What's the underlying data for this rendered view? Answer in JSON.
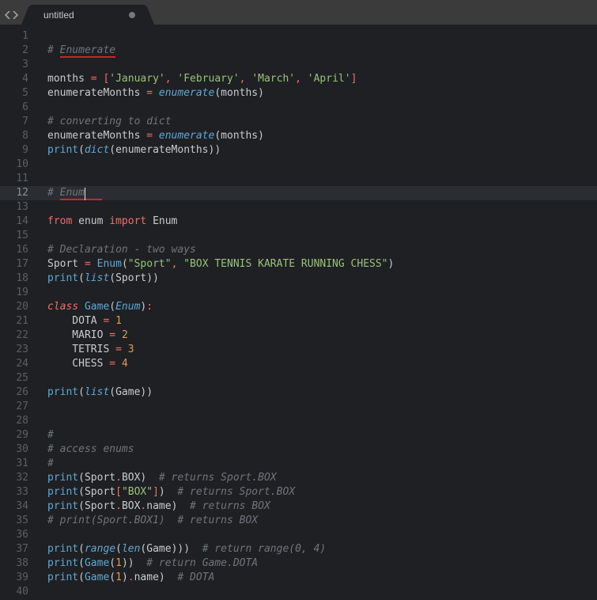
{
  "tab": {
    "title": "untitled",
    "modified": true
  },
  "gutter": {
    "start": 1,
    "end": 40,
    "active_line": 12
  },
  "underlines": {
    "enumerate": {
      "text": "Enumerate"
    },
    "enum": {
      "text": "Enum"
    }
  },
  "cursor": {
    "line": 12,
    "after_text": "# Enum"
  },
  "code": {
    "lines": [
      {
        "n": 1,
        "tokens": []
      },
      {
        "n": 2,
        "tokens": [
          {
            "t": "# ",
            "c": "cm"
          },
          {
            "t": "Enumerate",
            "c": "cm",
            "u": true
          }
        ]
      },
      {
        "n": 3,
        "tokens": []
      },
      {
        "n": 4,
        "tokens": [
          {
            "t": "months ",
            "c": "ident"
          },
          {
            "t": "=",
            "c": "op"
          },
          {
            "t": " ",
            "c": "txt"
          },
          {
            "t": "[",
            "c": "op"
          },
          {
            "t": "'January'",
            "c": "str"
          },
          {
            "t": ",",
            "c": "op"
          },
          {
            "t": " ",
            "c": "txt"
          },
          {
            "t": "'February'",
            "c": "str"
          },
          {
            "t": ",",
            "c": "op"
          },
          {
            "t": " ",
            "c": "txt"
          },
          {
            "t": "'March'",
            "c": "str"
          },
          {
            "t": ",",
            "c": "op"
          },
          {
            "t": " ",
            "c": "txt"
          },
          {
            "t": "'April'",
            "c": "str"
          },
          {
            "t": "]",
            "c": "op"
          }
        ]
      },
      {
        "n": 5,
        "tokens": [
          {
            "t": "enumerateMonths ",
            "c": "ident"
          },
          {
            "t": "=",
            "c": "op"
          },
          {
            "t": " ",
            "c": "txt"
          },
          {
            "t": "enumerate",
            "c": "cls"
          },
          {
            "t": "(",
            "c": "txt"
          },
          {
            "t": "months",
            "c": "ident"
          },
          {
            "t": ")",
            "c": "txt"
          }
        ]
      },
      {
        "n": 6,
        "tokens": []
      },
      {
        "n": 7,
        "tokens": [
          {
            "t": "# converting to dict",
            "c": "cm"
          }
        ]
      },
      {
        "n": 8,
        "tokens": [
          {
            "t": "enumerateMonths ",
            "c": "ident"
          },
          {
            "t": "=",
            "c": "op"
          },
          {
            "t": " ",
            "c": "txt"
          },
          {
            "t": "enumerate",
            "c": "cls"
          },
          {
            "t": "(",
            "c": "txt"
          },
          {
            "t": "months",
            "c": "ident"
          },
          {
            "t": ")",
            "c": "txt"
          }
        ]
      },
      {
        "n": 9,
        "tokens": [
          {
            "t": "print",
            "c": "fn"
          },
          {
            "t": "(",
            "c": "txt"
          },
          {
            "t": "dict",
            "c": "cls"
          },
          {
            "t": "(",
            "c": "txt"
          },
          {
            "t": "enumerateMonths",
            "c": "ident"
          },
          {
            "t": ")",
            "c": "txt"
          },
          {
            "t": ")",
            "c": "txt"
          }
        ]
      },
      {
        "n": 10,
        "tokens": []
      },
      {
        "n": 11,
        "tokens": []
      },
      {
        "n": 12,
        "active": true,
        "tokens": [
          {
            "t": "# ",
            "c": "cm"
          },
          {
            "t": "Enum",
            "c": "cm",
            "u": true,
            "caret_after": true
          }
        ]
      },
      {
        "n": 13,
        "tokens": []
      },
      {
        "n": 14,
        "tokens": [
          {
            "t": "from",
            "c": "kw"
          },
          {
            "t": " enum ",
            "c": "ident"
          },
          {
            "t": "import",
            "c": "kw"
          },
          {
            "t": " Enum",
            "c": "ident"
          }
        ]
      },
      {
        "n": 15,
        "tokens": []
      },
      {
        "n": 16,
        "tokens": [
          {
            "t": "# Declaration - two ways",
            "c": "cm"
          }
        ]
      },
      {
        "n": 17,
        "tokens": [
          {
            "t": "Sport ",
            "c": "ident"
          },
          {
            "t": "=",
            "c": "op"
          },
          {
            "t": " ",
            "c": "txt"
          },
          {
            "t": "Enum",
            "c": "fn"
          },
          {
            "t": "(",
            "c": "txt"
          },
          {
            "t": "\"Sport\"",
            "c": "str"
          },
          {
            "t": ",",
            "c": "op"
          },
          {
            "t": " ",
            "c": "txt"
          },
          {
            "t": "\"BOX TENNIS KARATE RUNNING CHESS\"",
            "c": "str"
          },
          {
            "t": ")",
            "c": "txt"
          }
        ]
      },
      {
        "n": 18,
        "tokens": [
          {
            "t": "print",
            "c": "fn"
          },
          {
            "t": "(",
            "c": "txt"
          },
          {
            "t": "list",
            "c": "cls"
          },
          {
            "t": "(",
            "c": "txt"
          },
          {
            "t": "Sport",
            "c": "ident"
          },
          {
            "t": ")",
            "c": "txt"
          },
          {
            "t": ")",
            "c": "txt"
          }
        ]
      },
      {
        "n": 19,
        "tokens": []
      },
      {
        "n": 20,
        "tokens": [
          {
            "t": "class",
            "c": "stor"
          },
          {
            "t": " ",
            "c": "txt"
          },
          {
            "t": "Game",
            "c": "fn"
          },
          {
            "t": "(",
            "c": "txt"
          },
          {
            "t": "Enum",
            "c": "cls"
          },
          {
            "t": ")",
            "c": "txt"
          },
          {
            "t": ":",
            "c": "op"
          }
        ]
      },
      {
        "n": 21,
        "tokens": [
          {
            "t": "    DOTA ",
            "c": "ident"
          },
          {
            "t": "=",
            "c": "op"
          },
          {
            "t": " ",
            "c": "txt"
          },
          {
            "t": "1",
            "c": "num"
          }
        ]
      },
      {
        "n": 22,
        "tokens": [
          {
            "t": "    MARIO ",
            "c": "ident"
          },
          {
            "t": "=",
            "c": "op"
          },
          {
            "t": " ",
            "c": "txt"
          },
          {
            "t": "2",
            "c": "num"
          }
        ]
      },
      {
        "n": 23,
        "tokens": [
          {
            "t": "    TETRIS ",
            "c": "ident"
          },
          {
            "t": "=",
            "c": "op"
          },
          {
            "t": " ",
            "c": "txt"
          },
          {
            "t": "3",
            "c": "num"
          }
        ]
      },
      {
        "n": 24,
        "tokens": [
          {
            "t": "    CHESS ",
            "c": "ident"
          },
          {
            "t": "=",
            "c": "op"
          },
          {
            "t": " ",
            "c": "txt"
          },
          {
            "t": "4",
            "c": "num"
          }
        ]
      },
      {
        "n": 25,
        "tokens": []
      },
      {
        "n": 26,
        "tokens": [
          {
            "t": "print",
            "c": "fn"
          },
          {
            "t": "(",
            "c": "txt"
          },
          {
            "t": "list",
            "c": "cls"
          },
          {
            "t": "(",
            "c": "txt"
          },
          {
            "t": "Game",
            "c": "ident"
          },
          {
            "t": ")",
            "c": "txt"
          },
          {
            "t": ")",
            "c": "txt"
          }
        ]
      },
      {
        "n": 27,
        "tokens": []
      },
      {
        "n": 28,
        "tokens": []
      },
      {
        "n": 29,
        "tokens": [
          {
            "t": "#",
            "c": "cm"
          }
        ]
      },
      {
        "n": 30,
        "tokens": [
          {
            "t": "# access enums",
            "c": "cm"
          }
        ]
      },
      {
        "n": 31,
        "tokens": [
          {
            "t": "#",
            "c": "cm"
          }
        ]
      },
      {
        "n": 32,
        "tokens": [
          {
            "t": "print",
            "c": "fn"
          },
          {
            "t": "(",
            "c": "txt"
          },
          {
            "t": "Sport",
            "c": "ident"
          },
          {
            "t": ".",
            "c": "op"
          },
          {
            "t": "BOX",
            "c": "ident"
          },
          {
            "t": ")",
            "c": "txt"
          },
          {
            "t": "  ",
            "c": "txt"
          },
          {
            "t": "# returns Sport.BOX",
            "c": "cm"
          }
        ]
      },
      {
        "n": 33,
        "tokens": [
          {
            "t": "print",
            "c": "fn"
          },
          {
            "t": "(",
            "c": "txt"
          },
          {
            "t": "Sport",
            "c": "ident"
          },
          {
            "t": "[",
            "c": "op"
          },
          {
            "t": "\"BOX\"",
            "c": "str"
          },
          {
            "t": "]",
            "c": "op"
          },
          {
            "t": ")",
            "c": "txt"
          },
          {
            "t": "  ",
            "c": "txt"
          },
          {
            "t": "# returns Sport.BOX",
            "c": "cm"
          }
        ]
      },
      {
        "n": 34,
        "tokens": [
          {
            "t": "print",
            "c": "fn"
          },
          {
            "t": "(",
            "c": "txt"
          },
          {
            "t": "Sport",
            "c": "ident"
          },
          {
            "t": ".",
            "c": "op"
          },
          {
            "t": "BOX",
            "c": "ident"
          },
          {
            "t": ".",
            "c": "op"
          },
          {
            "t": "name",
            "c": "ident"
          },
          {
            "t": ")",
            "c": "txt"
          },
          {
            "t": "  ",
            "c": "txt"
          },
          {
            "t": "# returns BOX",
            "c": "cm"
          }
        ]
      },
      {
        "n": 35,
        "tokens": [
          {
            "t": "# print(Sport.BOX1)  # returns BOX",
            "c": "cm"
          }
        ]
      },
      {
        "n": 36,
        "tokens": []
      },
      {
        "n": 37,
        "tokens": [
          {
            "t": "print",
            "c": "fn"
          },
          {
            "t": "(",
            "c": "txt"
          },
          {
            "t": "range",
            "c": "cls"
          },
          {
            "t": "(",
            "c": "txt"
          },
          {
            "t": "len",
            "c": "cls"
          },
          {
            "t": "(",
            "c": "txt"
          },
          {
            "t": "Game",
            "c": "ident"
          },
          {
            "t": ")",
            "c": "txt"
          },
          {
            "t": ")",
            "c": "txt"
          },
          {
            "t": ")",
            "c": "txt"
          },
          {
            "t": "  ",
            "c": "txt"
          },
          {
            "t": "# return range(0, 4)",
            "c": "cm"
          }
        ]
      },
      {
        "n": 38,
        "tokens": [
          {
            "t": "print",
            "c": "fn"
          },
          {
            "t": "(",
            "c": "txt"
          },
          {
            "t": "Game",
            "c": "fn"
          },
          {
            "t": "(",
            "c": "txt"
          },
          {
            "t": "1",
            "c": "num"
          },
          {
            "t": ")",
            "c": "txt"
          },
          {
            "t": ")",
            "c": "txt"
          },
          {
            "t": "  ",
            "c": "txt"
          },
          {
            "t": "# return Game.DOTA",
            "c": "cm"
          }
        ]
      },
      {
        "n": 39,
        "tokens": [
          {
            "t": "print",
            "c": "fn"
          },
          {
            "t": "(",
            "c": "txt"
          },
          {
            "t": "Game",
            "c": "fn"
          },
          {
            "t": "(",
            "c": "txt"
          },
          {
            "t": "1",
            "c": "num"
          },
          {
            "t": ")",
            "c": "txt"
          },
          {
            "t": ".",
            "c": "op"
          },
          {
            "t": "name",
            "c": "ident"
          },
          {
            "t": ")",
            "c": "txt"
          },
          {
            "t": "  ",
            "c": "txt"
          },
          {
            "t": "# DOTA",
            "c": "cm"
          }
        ]
      },
      {
        "n": 40,
        "tokens": []
      }
    ]
  }
}
